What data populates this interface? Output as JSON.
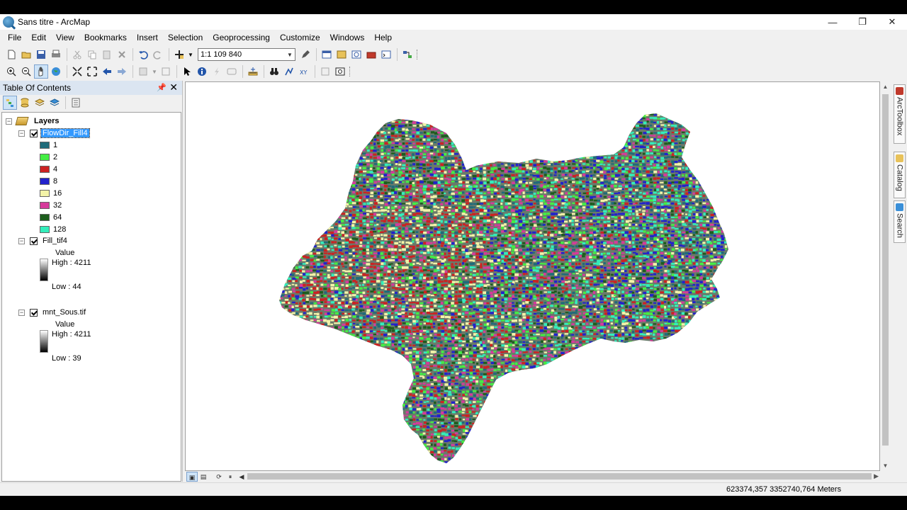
{
  "window": {
    "title": "Sans titre - ArcMap",
    "min": "—",
    "restore": "❐",
    "close": "✕"
  },
  "menu": [
    "File",
    "Edit",
    "View",
    "Bookmarks",
    "Insert",
    "Selection",
    "Geoprocessing",
    "Customize",
    "Windows",
    "Help"
  ],
  "toolbar": {
    "scale_value": "1:1 109 840"
  },
  "toc": {
    "title": "Table Of Contents",
    "root": "Layers",
    "layers": [
      {
        "name": "FlowDir_Fill4",
        "checked": true,
        "selected": true,
        "classes": [
          {
            "label": "1",
            "color": "#1f6b7a"
          },
          {
            "label": "2",
            "color": "#44ee44"
          },
          {
            "label": "4",
            "color": "#cc2222"
          },
          {
            "label": "8",
            "color": "#2222cc"
          },
          {
            "label": "16",
            "color": "#f3f3a8"
          },
          {
            "label": "32",
            "color": "#d63a9b"
          },
          {
            "label": "64",
            "color": "#1d5d1d"
          },
          {
            "label": "128",
            "color": "#33eebb"
          }
        ]
      },
      {
        "name": "Fill_tif4",
        "checked": true,
        "field": "Value",
        "high": "High : 4211",
        "low": "Low : 44"
      },
      {
        "name": "mnt_Sous.tif",
        "checked": true,
        "field": "Value",
        "high": "High : 4211",
        "low": "Low : 39"
      }
    ]
  },
  "dock_tabs": [
    "ArcToolbox",
    "Catalog",
    "Search"
  ],
  "status": {
    "coordinates": "623374,357  3352740,764 Meters"
  },
  "colors": {
    "selection": "#3399ff",
    "toc_header": "#dbe5f1"
  }
}
